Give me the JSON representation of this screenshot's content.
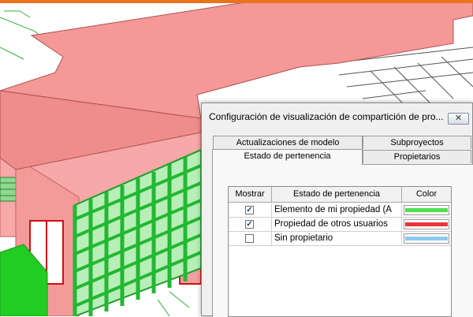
{
  "dialog": {
    "title": "Configuración de visualización de compartición de pro...",
    "close_glyph": "✕",
    "tabs": {
      "actualizaciones": "Actualizaciones de modelo",
      "subproyectos": "Subproyectos",
      "estado": "Estado de pertenencia",
      "propietarios": "Propietarios"
    },
    "active_tab": "Estado de pertenencia",
    "table": {
      "headers": {
        "mostrar": "Mostrar",
        "estado": "Estado de pertenencia",
        "color": "Color"
      },
      "rows": [
        {
          "checked": true,
          "check_glyph": "✓",
          "label": "Elemento de mi propiedad (A",
          "color": "#4fe04f"
        },
        {
          "checked": true,
          "check_glyph": "✓",
          "label": "Propiedad de otros usuarios",
          "color": "#e8333a"
        },
        {
          "checked": false,
          "check_glyph": "",
          "label": "Sin propietario",
          "color": "#8ccaf0"
        }
      ]
    }
  },
  "colors": {
    "roof": "#f49898",
    "wall": "#f7a8a8",
    "curtain_green": "#22b832",
    "accent_bar": "#e8741e"
  }
}
